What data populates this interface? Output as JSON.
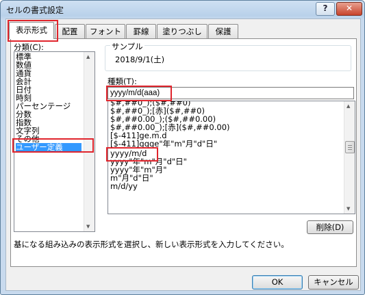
{
  "window": {
    "title": "セルの書式設定",
    "help_label": "?",
    "close_label": "✕"
  },
  "tabs": [
    {
      "label": "表示形式",
      "active": true
    },
    {
      "label": "配置"
    },
    {
      "label": "フォント"
    },
    {
      "label": "罫線"
    },
    {
      "label": "塗りつぶし"
    },
    {
      "label": "保護"
    }
  ],
  "category": {
    "label": "分類(C):",
    "items": [
      "標準",
      "数値",
      "通貨",
      "会計",
      "日付",
      "時刻",
      "パーセンテージ",
      "分数",
      "指数",
      "文字列",
      "その他",
      "ユーザー定義"
    ],
    "selected": "ユーザー定義"
  },
  "sample": {
    "label": "サンプル",
    "value": "2018/9/1(土)"
  },
  "type": {
    "label": "種類(T):",
    "input_value": "yyyy/m/d(aaa)",
    "items": [
      "$#,##0_);($#,##0)",
      "$#,##0_);[赤]($#,##0)",
      "$#,##0.00_);($#,##0.00)",
      "$#,##0.00_);[赤]($#,##0.00)",
      "[$-411]ge.m.d",
      "[$-411]ggge\"年\"m\"月\"d\"日\"",
      "yyyy/m/d",
      "yyyy\"年\"m\"月\"d\"日\"",
      "yyyy\"年\"m\"月\"",
      "m\"月\"d\"日\"",
      "m/d/yy"
    ]
  },
  "delete_label": "削除(D)",
  "description": "基になる組み込みの表示形式を選択し、新しい表示形式を入力してください。",
  "ok_label": "OK",
  "cancel_label": "キャンセル",
  "highlight_color": "#e0242c"
}
